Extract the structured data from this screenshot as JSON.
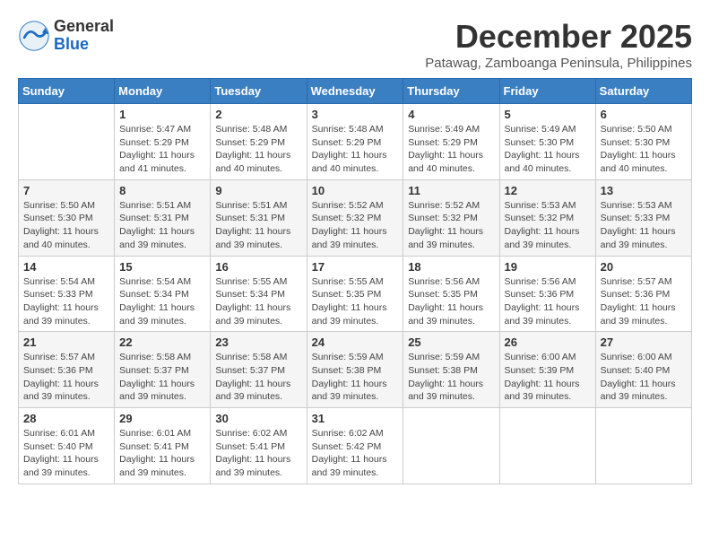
{
  "header": {
    "logo_general": "General",
    "logo_blue": "Blue",
    "month_title": "December 2025",
    "location": "Patawag, Zamboanga Peninsula, Philippines"
  },
  "calendar": {
    "days_of_week": [
      "Sunday",
      "Monday",
      "Tuesday",
      "Wednesday",
      "Thursday",
      "Friday",
      "Saturday"
    ],
    "weeks": [
      [
        {
          "day": "",
          "info": ""
        },
        {
          "day": "1",
          "info": "Sunrise: 5:47 AM\nSunset: 5:29 PM\nDaylight: 11 hours\nand 41 minutes."
        },
        {
          "day": "2",
          "info": "Sunrise: 5:48 AM\nSunset: 5:29 PM\nDaylight: 11 hours\nand 40 minutes."
        },
        {
          "day": "3",
          "info": "Sunrise: 5:48 AM\nSunset: 5:29 PM\nDaylight: 11 hours\nand 40 minutes."
        },
        {
          "day": "4",
          "info": "Sunrise: 5:49 AM\nSunset: 5:29 PM\nDaylight: 11 hours\nand 40 minutes."
        },
        {
          "day": "5",
          "info": "Sunrise: 5:49 AM\nSunset: 5:30 PM\nDaylight: 11 hours\nand 40 minutes."
        },
        {
          "day": "6",
          "info": "Sunrise: 5:50 AM\nSunset: 5:30 PM\nDaylight: 11 hours\nand 40 minutes."
        }
      ],
      [
        {
          "day": "7",
          "info": "Sunrise: 5:50 AM\nSunset: 5:30 PM\nDaylight: 11 hours\nand 40 minutes."
        },
        {
          "day": "8",
          "info": "Sunrise: 5:51 AM\nSunset: 5:31 PM\nDaylight: 11 hours\nand 39 minutes."
        },
        {
          "day": "9",
          "info": "Sunrise: 5:51 AM\nSunset: 5:31 PM\nDaylight: 11 hours\nand 39 minutes."
        },
        {
          "day": "10",
          "info": "Sunrise: 5:52 AM\nSunset: 5:32 PM\nDaylight: 11 hours\nand 39 minutes."
        },
        {
          "day": "11",
          "info": "Sunrise: 5:52 AM\nSunset: 5:32 PM\nDaylight: 11 hours\nand 39 minutes."
        },
        {
          "day": "12",
          "info": "Sunrise: 5:53 AM\nSunset: 5:32 PM\nDaylight: 11 hours\nand 39 minutes."
        },
        {
          "day": "13",
          "info": "Sunrise: 5:53 AM\nSunset: 5:33 PM\nDaylight: 11 hours\nand 39 minutes."
        }
      ],
      [
        {
          "day": "14",
          "info": "Sunrise: 5:54 AM\nSunset: 5:33 PM\nDaylight: 11 hours\nand 39 minutes."
        },
        {
          "day": "15",
          "info": "Sunrise: 5:54 AM\nSunset: 5:34 PM\nDaylight: 11 hours\nand 39 minutes."
        },
        {
          "day": "16",
          "info": "Sunrise: 5:55 AM\nSunset: 5:34 PM\nDaylight: 11 hours\nand 39 minutes."
        },
        {
          "day": "17",
          "info": "Sunrise: 5:55 AM\nSunset: 5:35 PM\nDaylight: 11 hours\nand 39 minutes."
        },
        {
          "day": "18",
          "info": "Sunrise: 5:56 AM\nSunset: 5:35 PM\nDaylight: 11 hours\nand 39 minutes."
        },
        {
          "day": "19",
          "info": "Sunrise: 5:56 AM\nSunset: 5:36 PM\nDaylight: 11 hours\nand 39 minutes."
        },
        {
          "day": "20",
          "info": "Sunrise: 5:57 AM\nSunset: 5:36 PM\nDaylight: 11 hours\nand 39 minutes."
        }
      ],
      [
        {
          "day": "21",
          "info": "Sunrise: 5:57 AM\nSunset: 5:36 PM\nDaylight: 11 hours\nand 39 minutes."
        },
        {
          "day": "22",
          "info": "Sunrise: 5:58 AM\nSunset: 5:37 PM\nDaylight: 11 hours\nand 39 minutes."
        },
        {
          "day": "23",
          "info": "Sunrise: 5:58 AM\nSunset: 5:37 PM\nDaylight: 11 hours\nand 39 minutes."
        },
        {
          "day": "24",
          "info": "Sunrise: 5:59 AM\nSunset: 5:38 PM\nDaylight: 11 hours\nand 39 minutes."
        },
        {
          "day": "25",
          "info": "Sunrise: 5:59 AM\nSunset: 5:38 PM\nDaylight: 11 hours\nand 39 minutes."
        },
        {
          "day": "26",
          "info": "Sunrise: 6:00 AM\nSunset: 5:39 PM\nDaylight: 11 hours\nand 39 minutes."
        },
        {
          "day": "27",
          "info": "Sunrise: 6:00 AM\nSunset: 5:40 PM\nDaylight: 11 hours\nand 39 minutes."
        }
      ],
      [
        {
          "day": "28",
          "info": "Sunrise: 6:01 AM\nSunset: 5:40 PM\nDaylight: 11 hours\nand 39 minutes."
        },
        {
          "day": "29",
          "info": "Sunrise: 6:01 AM\nSunset: 5:41 PM\nDaylight: 11 hours\nand 39 minutes."
        },
        {
          "day": "30",
          "info": "Sunrise: 6:02 AM\nSunset: 5:41 PM\nDaylight: 11 hours\nand 39 minutes."
        },
        {
          "day": "31",
          "info": "Sunrise: 6:02 AM\nSunset: 5:42 PM\nDaylight: 11 hours\nand 39 minutes."
        },
        {
          "day": "",
          "info": ""
        },
        {
          "day": "",
          "info": ""
        },
        {
          "day": "",
          "info": ""
        }
      ]
    ]
  }
}
